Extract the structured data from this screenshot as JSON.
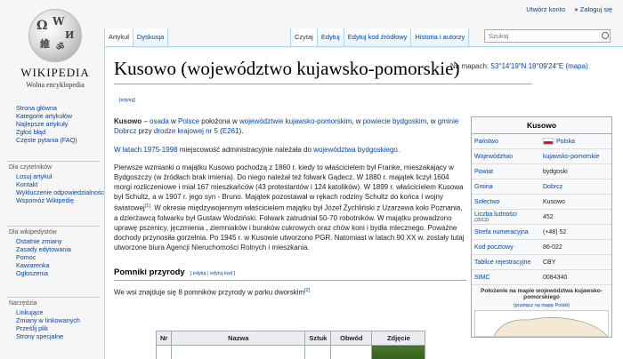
{
  "logo": {
    "wordmark": "WIKIPEDIA",
    "tagline": "Wolna encyklopedia"
  },
  "user_links": {
    "create_account": "Utwórz konto",
    "login": "Zaloguj się"
  },
  "tabs_left": [
    "Artykuł",
    "Dyskusja"
  ],
  "tabs_right": [
    "Czytaj",
    "Edytuj",
    "Edytuj kod źródłowy",
    "Historia i autorzy"
  ],
  "search": {
    "placeholder": "Szukaj"
  },
  "sidebar": {
    "nav": [
      "Strona główna",
      "Kategorie artykułów",
      "Najlepsze artykuły",
      "Zgłoś błąd",
      "Częste pytania (FAQ)"
    ],
    "readers_head": "Dla czytelników",
    "readers": [
      "Losuj artykuł",
      "Kontakt",
      "Wykluczenie odpowiedzialności",
      "Wspomóż Wikipedię"
    ],
    "editors_head": "Dla wikipedystów",
    "editors": [
      "Ostatnie zmiany",
      "Zasady edytowania",
      "Pomoc",
      "Kawiarenka",
      "Ogłoszenia"
    ],
    "tools_head": "Narzędzia",
    "tools": [
      "Linkujące",
      "Zmiany w linkowanych",
      "Prześlij plik",
      "Strony specjalne"
    ]
  },
  "article": {
    "title": "Kusowo (województwo kujawsko-pomorskie)",
    "coords_label": "Na mapach:",
    "coords": "53°14′19″N 18°09′24″E",
    "coords_map": "(mapa)",
    "edit_small": "[edytuj]",
    "p1": {
      "bold": "Kusowo",
      "dash": " – ",
      "l1": "osada",
      "t1": " w ",
      "l2": "Polsce",
      "t2": " położona w ",
      "l3": "województwie kujawsko-pomorskim",
      "t3": ", w ",
      "l4": "powiecie bydgoskim",
      "t4": ", w ",
      "l5": "gminie Dobrcz",
      "t5": " przy ",
      "l6": "drodze krajowej nr 5",
      "t6": " (",
      "l7": "E261",
      "t7": ")."
    },
    "p2": {
      "t0": "",
      "l1": "W latach 1975-1998",
      "t1": " miejscowość administracyjnie należała do ",
      "l2": "województwa bydgoskiego",
      "t2": "."
    },
    "p3a": "Pierwsze wzmianki o majątku Kusowo pochodzą z 1860 r. kiedy to właścicielem był Franke, mieszakający w Bydgoszczy (w źródłach brak imienia). Do niego należał też folwark Gądecz. W 1880 r. majątek liczył 1604 morgi rozliczeniowe i miał 167 mieszkańców (43 protestantów i 124 katolików). W 1899 r. właścicielem Kusowa był Schultz, a w 1907 r. jego syn - Bruno. Majątek pozostawał w rękach rodziny Schultz do końca I wojny światowej",
    "p3sup": "[1]",
    "p3b": ". W okresie międzywojennym właścicielem majątku był Józef Żychliński z Uzarzewa koło Poznania, a dzierżawcą folwarku był Gustaw Wodziński. Folwark zatrudniał 50-70 robotników. W majątku prowadzono uprawę pszenicy, jęczmienia , ziemniaków i buraków cukrowych oraz chów koni i bydła mlecznego. Poważne dochody przynosiła gorzelnia. Po 1945 r. w Kusowie utworzono PGR. Natomiast w latach 90 XX w. zostały tutaj utworzone biura Agencji Nieruchomości Rolnych i mieszkania.",
    "section": "Pomniki przyrody",
    "section_edit1": "[ edytuj",
    "section_edit2": "| edytuj kod ]",
    "p4": "We wsi znajduje się 8 pomników przyrody w parku dworskim",
    "p4sup": "[2]",
    "table_headers": [
      "Nr",
      "Nazwa",
      "Sztuk",
      "Obwód",
      "Zdjęcie"
    ]
  },
  "infobox": {
    "title": "Kusowo",
    "rows": [
      {
        "k": "Państwo",
        "v": "Polska",
        "flag": true,
        "link": true
      },
      {
        "k": "Województwo",
        "v": "kujawsko-pomorskie",
        "link": true
      },
      {
        "k": "Powiat",
        "v": "bydgoski"
      },
      {
        "k": "Gmina",
        "v": "Dobrcz",
        "link": true
      },
      {
        "k": "Sołectwo",
        "v": "Kusowo"
      },
      {
        "k": "Liczba ludności",
        "ksub": "(2013)",
        "v": "452"
      },
      {
        "k": "Strefa numeracyjna",
        "v": "(+48) 52"
      },
      {
        "k": "Kod pocztowy",
        "v": "86-022"
      },
      {
        "k": "Tablice rejestracyjne",
        "v": "CBY"
      },
      {
        "k": "SIMC",
        "v": "0084340"
      }
    ],
    "map_head": "Położenie na mapie województwa kujawsko-pomorskiego",
    "map_link": "(przełącz na mapę Polski)"
  },
  "colors": {
    "link": "#0645ad",
    "tab_border": "#a7d7f9",
    "flag_red": "#dc143c"
  }
}
